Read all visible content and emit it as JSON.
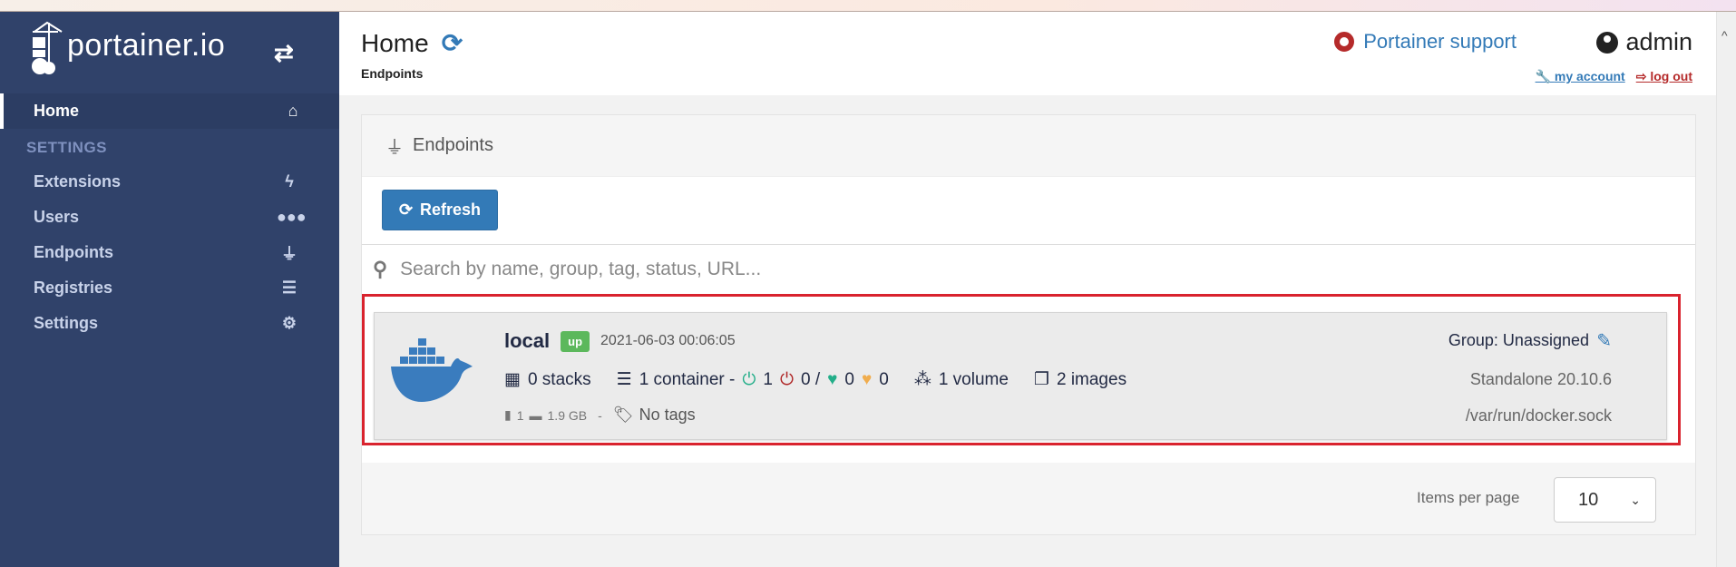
{
  "sidebar": {
    "logo_text": "portainer.io",
    "home": "Home",
    "section": "SETTINGS",
    "items": [
      {
        "label": "Extensions",
        "icon": "bolt-icon"
      },
      {
        "label": "Users",
        "icon": "users-icon"
      },
      {
        "label": "Endpoints",
        "icon": "plug-icon"
      },
      {
        "label": "Registries",
        "icon": "database-icon"
      },
      {
        "label": "Settings",
        "icon": "cogs-icon"
      }
    ],
    "color": "#30426a"
  },
  "header": {
    "title": "Home",
    "breadcrumb": "Endpoints",
    "support": "Portainer support",
    "user": "admin",
    "my_account": "my account",
    "log_out": "log out"
  },
  "panel": {
    "title": "Endpoints",
    "refresh": "Refresh",
    "search_placeholder": "Search by name, group, tag, status, URL..."
  },
  "endpoint": {
    "name": "local",
    "status": "up",
    "timestamp": "2021-06-03 00:06:05",
    "stacks": "0 stacks",
    "containers": "1 container -",
    "running": "1",
    "stopped": "0 /",
    "healthy": "0",
    "unhealthy": "0",
    "volumes": "1 volume",
    "images": "2 images",
    "cpu": "1",
    "memory": "1.9 GB",
    "separator": "-",
    "tags": "No tags",
    "group": "Group: Unassigned",
    "type": "Standalone 20.10.6",
    "url": "/var/run/docker.sock"
  },
  "pagination": {
    "label": "Items per page",
    "value": "10"
  },
  "colors": {
    "accent": "#337ab7",
    "up": "#5cb85c",
    "highlight": "#d9232e"
  }
}
